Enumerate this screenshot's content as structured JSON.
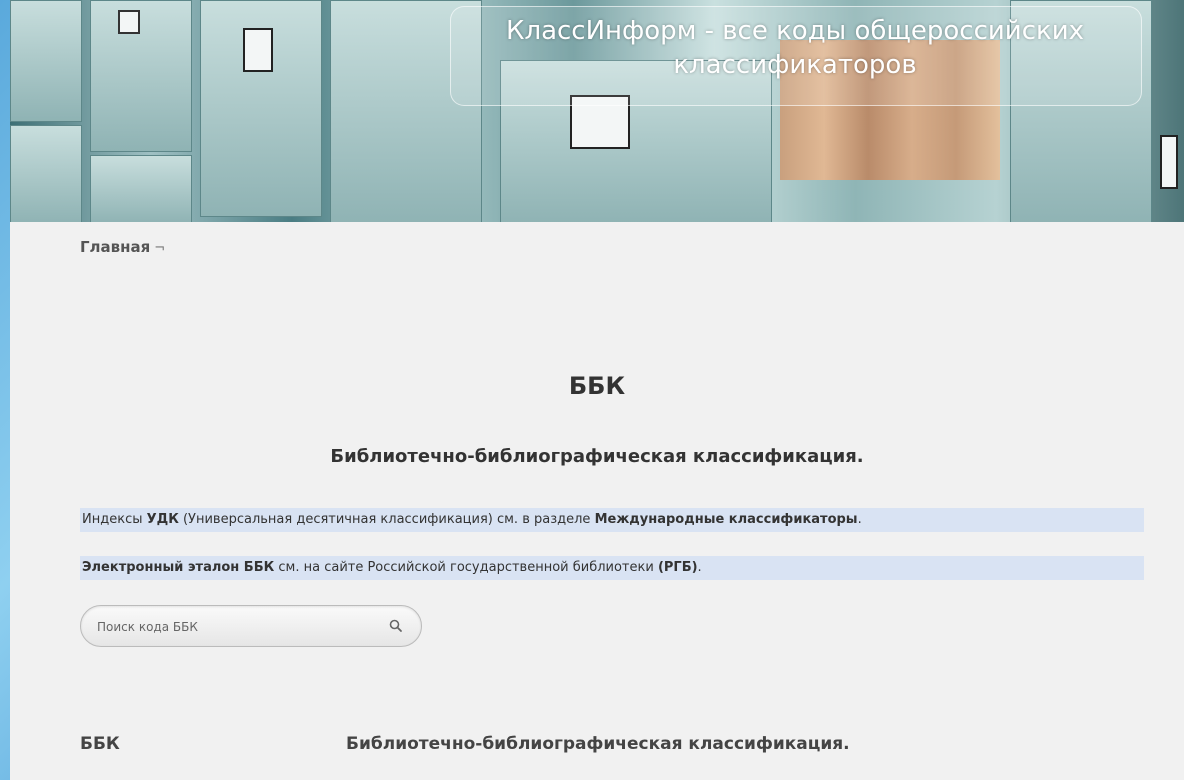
{
  "header": {
    "title_line1": "КлассИнформ - все коды общероссийских",
    "title_line2": "классификаторов"
  },
  "breadcrumb": {
    "home_label": "Главная",
    "arrow": "¬"
  },
  "main": {
    "heading": "ББК",
    "subheading": "Библиотечно-библиографическая классификация."
  },
  "notes": {
    "udk": {
      "prefix": "Индексы ",
      "udk_bold": "УДК",
      "middle": " (Универсальная десятичная классификация) см. в разделе ",
      "link_bold": "Международные классификаторы",
      "suffix": "."
    },
    "bbk": {
      "link_bold": "Электронный эталон ББК",
      "middle": " см. на сайте Российской государственной библиотеки ",
      "rgb_bold": "(РГБ)",
      "suffix": "."
    }
  },
  "search": {
    "placeholder": "Поиск кода ББК",
    "icon": "search-icon"
  },
  "table": {
    "rows": [
      {
        "code": "ББК",
        "name": "Библиотечно-библиографическая классификация."
      }
    ]
  }
}
